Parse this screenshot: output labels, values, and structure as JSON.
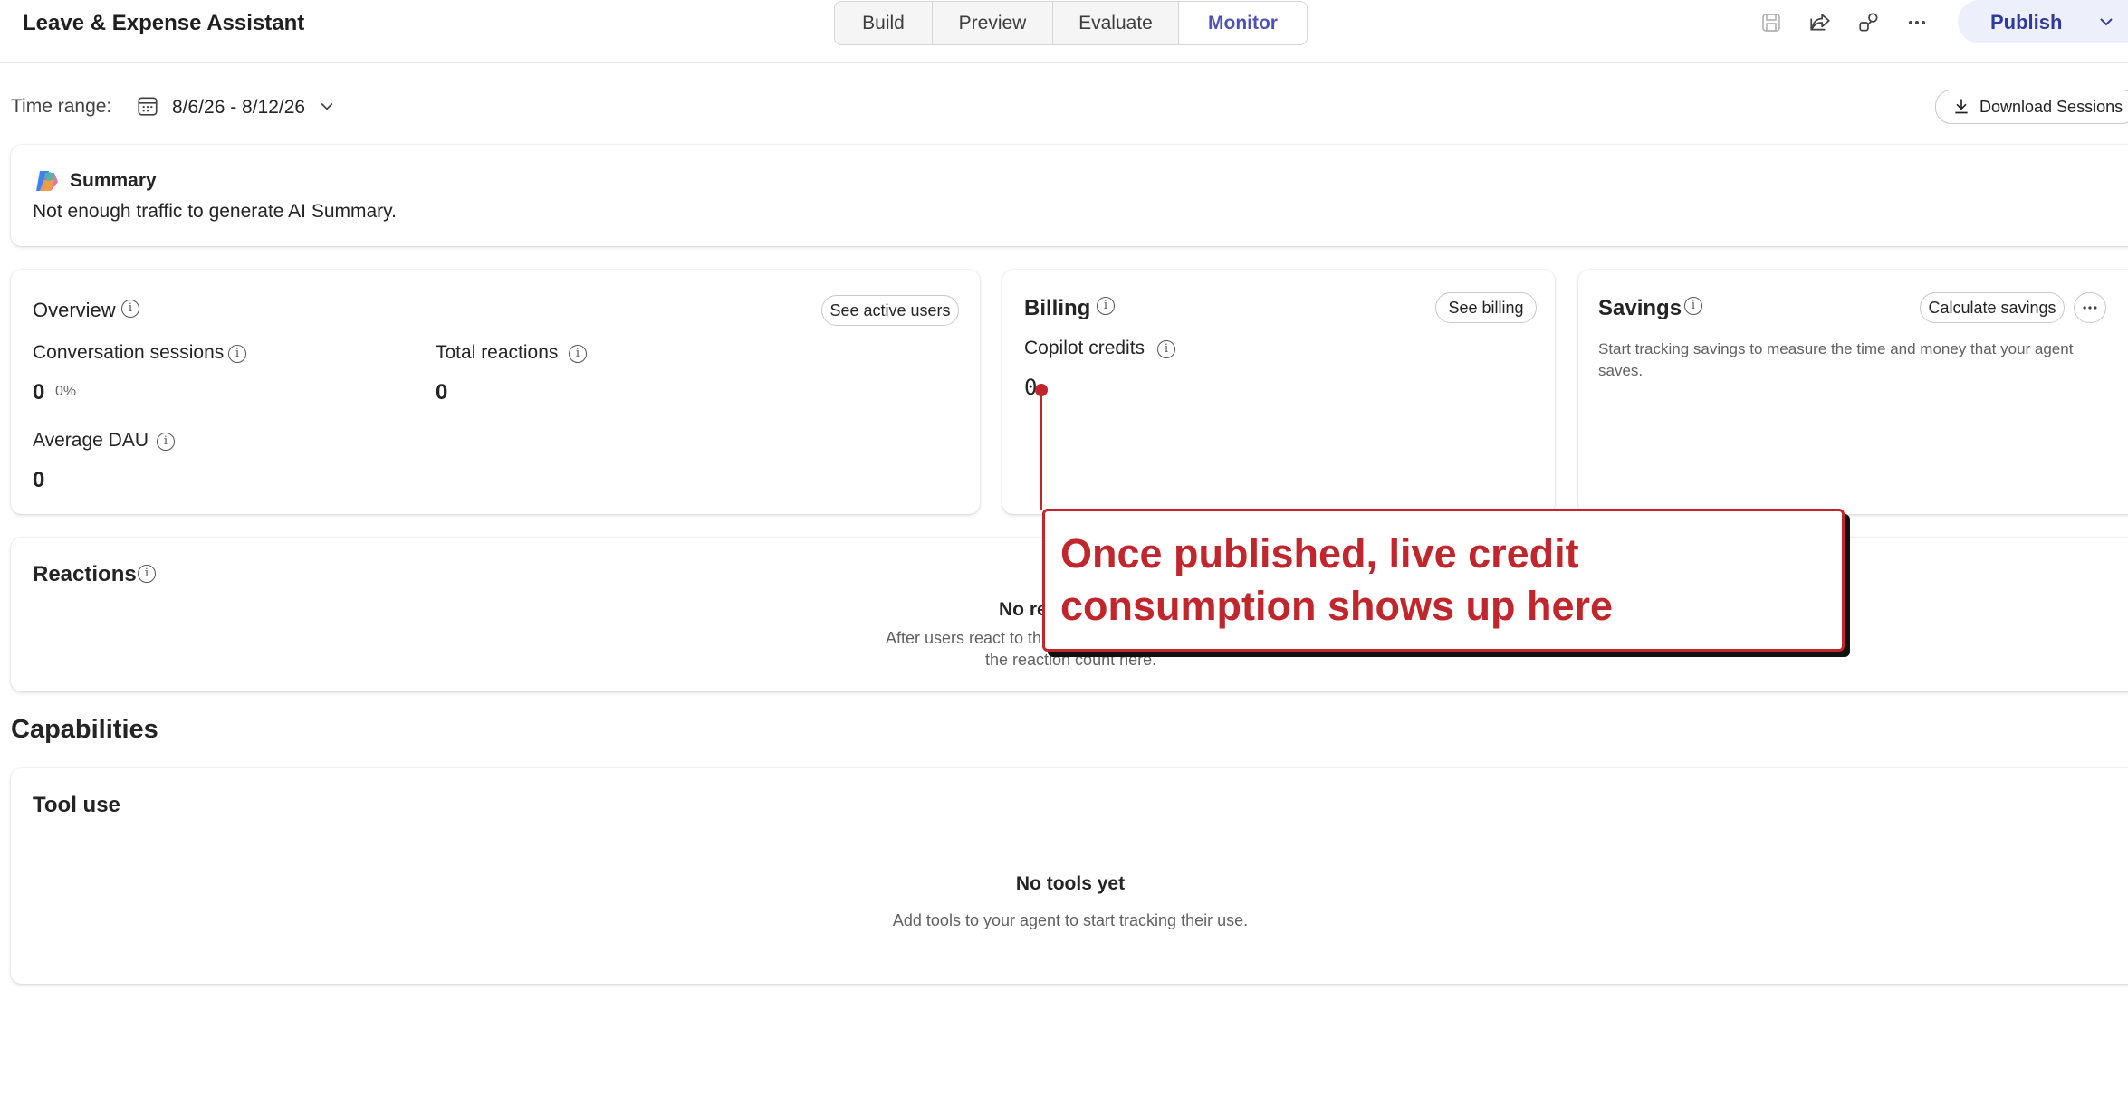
{
  "header": {
    "title": "Leave & Expense Assistant",
    "tabs": [
      {
        "label": "Build"
      },
      {
        "label": "Preview"
      },
      {
        "label": "Evaluate"
      },
      {
        "label": "Monitor"
      }
    ],
    "active_tab": "Monitor",
    "icons": [
      "save-icon",
      "share-icon",
      "connect-icon",
      "more-icon"
    ],
    "publish_label": "Publish"
  },
  "toolbar": {
    "time_range_label": "Time range:",
    "date_range": "8/6/26 - 8/12/26",
    "download_label": "Download Sessions"
  },
  "summary": {
    "title": "Summary",
    "text": "Not enough traffic to generate AI Summary."
  },
  "overview": {
    "title": "Overview",
    "button": "See active users",
    "conversation_sessions": {
      "label": "Conversation sessions",
      "value": "0",
      "pct": "0%"
    },
    "total_reactions": {
      "label": "Total reactions",
      "value": "0"
    },
    "average_dau": {
      "label": "Average DAU",
      "value": "0"
    }
  },
  "billing": {
    "title": "Billing",
    "button": "See billing",
    "metric_label": "Copilot credits",
    "metric_value": "0"
  },
  "savings": {
    "title": "Savings",
    "button": "Calculate savings",
    "text": "Start tracking savings to measure the time and money that your agent saves."
  },
  "reactions": {
    "title": "Reactions",
    "empty_title": "No re",
    "empty_line1": "After users react to th",
    "empty_line2": "the reaction count here."
  },
  "capabilities": {
    "heading": "Capabilities",
    "tool_use_title": "Tool use",
    "empty_title": "No tools yet",
    "empty_text": "Add tools to your agent to start tracking their use."
  },
  "annotation": {
    "text": "Once published, live credit consumption shows up here",
    "color": "#c0262c"
  },
  "colors": {
    "accent": "#4f52b2",
    "publish_bg": "#edf0fa",
    "annotation_red": "#c0262c"
  }
}
